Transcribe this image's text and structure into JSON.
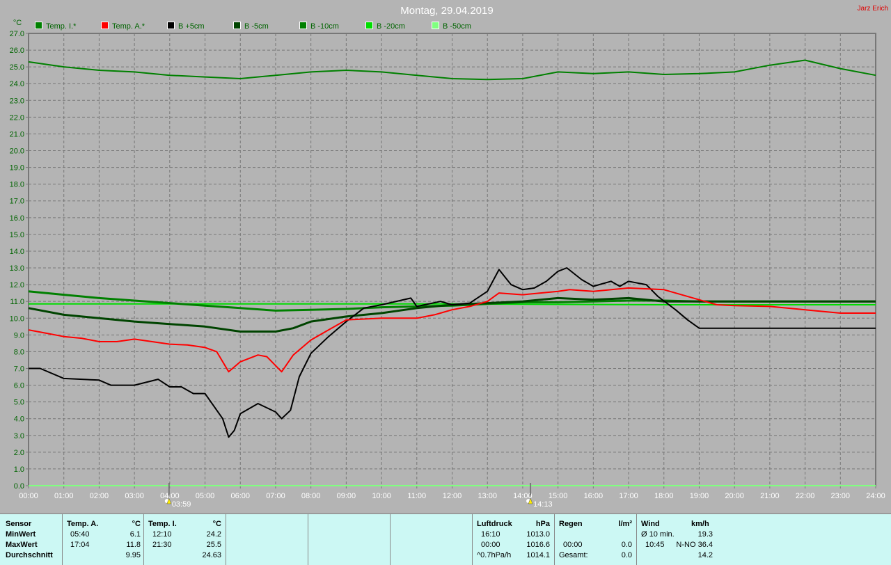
{
  "title": "Montag, 29.04.2019",
  "author": "Jarz Erich",
  "chart_data": {
    "type": "line",
    "title": "Montag, 29.04.2019",
    "ylabel": "°C",
    "xlabel": "",
    "ylim": [
      0,
      27
    ],
    "xlim": [
      0,
      24
    ],
    "grid": true,
    "legend_position": "top",
    "yticks": [
      "0.0",
      "1.0",
      "2.0",
      "3.0",
      "4.0",
      "5.0",
      "6.0",
      "7.0",
      "8.0",
      "9.0",
      "10.0",
      "11.0",
      "12.0",
      "13.0",
      "14.0",
      "15.0",
      "16.0",
      "17.0",
      "18.0",
      "19.0",
      "20.0",
      "21.0",
      "22.0",
      "23.0",
      "24.0",
      "25.0",
      "26.0",
      "27.0"
    ],
    "xticks": [
      "00:00",
      "01:00",
      "02:00",
      "03:00",
      "04:00",
      "05:00",
      "06:00",
      "07:00",
      "08:00",
      "09:00",
      "10:00",
      "11:00",
      "12:00",
      "13:00",
      "14:00",
      "15:00",
      "16:00",
      "17:00",
      "18:00",
      "19:00",
      "20:00",
      "21:00",
      "22:00",
      "23:00",
      "24:00"
    ],
    "markers": [
      {
        "label": "03:59",
        "hour": 3.98,
        "icon": "sunrise-icon"
      },
      {
        "label": "14:13",
        "hour": 14.22,
        "icon": "sunset-icon"
      }
    ],
    "series": [
      {
        "name": "Temp. I.*",
        "color": "#008000",
        "width": 2,
        "points": [
          [
            0,
            25.3
          ],
          [
            1,
            25.0
          ],
          [
            2,
            24.8
          ],
          [
            3,
            24.7
          ],
          [
            4,
            24.5
          ],
          [
            5,
            24.4
          ],
          [
            6,
            24.3
          ],
          [
            7,
            24.5
          ],
          [
            8,
            24.7
          ],
          [
            9,
            24.8
          ],
          [
            10,
            24.7
          ],
          [
            11,
            24.5
          ],
          [
            12,
            24.3
          ],
          [
            13,
            24.25
          ],
          [
            14,
            24.3
          ],
          [
            15,
            24.7
          ],
          [
            16,
            24.6
          ],
          [
            17,
            24.7
          ],
          [
            18,
            24.55
          ],
          [
            19,
            24.6
          ],
          [
            20,
            24.7
          ],
          [
            21,
            25.1
          ],
          [
            22,
            25.4
          ],
          [
            23,
            24.9
          ],
          [
            24,
            24.5
          ]
        ]
      },
      {
        "name": "Temp. A.*",
        "color": "#ff0000",
        "width": 2,
        "points": [
          [
            0,
            9.3
          ],
          [
            0.5,
            9.1
          ],
          [
            1,
            8.9
          ],
          [
            1.5,
            8.8
          ],
          [
            2,
            8.6
          ],
          [
            2.5,
            8.6
          ],
          [
            3,
            8.75
          ],
          [
            3.5,
            8.6
          ],
          [
            4,
            8.45
          ],
          [
            4.5,
            8.4
          ],
          [
            5,
            8.25
          ],
          [
            5.33,
            8.0
          ],
          [
            5.67,
            6.8
          ],
          [
            6,
            7.4
          ],
          [
            6.5,
            7.8
          ],
          [
            6.75,
            7.7
          ],
          [
            7.17,
            6.8
          ],
          [
            7.5,
            7.8
          ],
          [
            8,
            8.7
          ],
          [
            8.5,
            9.3
          ],
          [
            9,
            9.9
          ],
          [
            10,
            10.0
          ],
          [
            10.5,
            10.0
          ],
          [
            11,
            10.0
          ],
          [
            11.5,
            10.2
          ],
          [
            12,
            10.5
          ],
          [
            12.5,
            10.7
          ],
          [
            13,
            11.0
          ],
          [
            13.33,
            11.5
          ],
          [
            14,
            11.4
          ],
          [
            15,
            11.6
          ],
          [
            15.33,
            11.7
          ],
          [
            16,
            11.6
          ],
          [
            17,
            11.8
          ],
          [
            18,
            11.7
          ],
          [
            18.5,
            11.4
          ],
          [
            19,
            11.1
          ],
          [
            19.5,
            10.8
          ],
          [
            20,
            10.75
          ],
          [
            21,
            10.7
          ],
          [
            22,
            10.5
          ],
          [
            23,
            10.3
          ],
          [
            24,
            10.3
          ]
        ]
      },
      {
        "name": "B +5cm",
        "color": "#000000",
        "width": 2,
        "points": [
          [
            0,
            7.0
          ],
          [
            0.33,
            7.0
          ],
          [
            1,
            6.4
          ],
          [
            2,
            6.3
          ],
          [
            2.33,
            6.0
          ],
          [
            3,
            6.0
          ],
          [
            3.67,
            6.35
          ],
          [
            4,
            5.9
          ],
          [
            4.33,
            5.9
          ],
          [
            4.67,
            5.5
          ],
          [
            5,
            5.5
          ],
          [
            5.5,
            4.0
          ],
          [
            5.67,
            2.9
          ],
          [
            5.83,
            3.3
          ],
          [
            6,
            4.3
          ],
          [
            6.5,
            4.9
          ],
          [
            7,
            4.4
          ],
          [
            7.17,
            4.0
          ],
          [
            7.42,
            4.5
          ],
          [
            7.67,
            6.5
          ],
          [
            8,
            7.9
          ],
          [
            8.5,
            8.9
          ],
          [
            9,
            9.8
          ],
          [
            9.5,
            10.6
          ],
          [
            10,
            10.8
          ],
          [
            10.83,
            11.2
          ],
          [
            11,
            10.7
          ],
          [
            11.67,
            11.0
          ],
          [
            12,
            10.8
          ],
          [
            12.5,
            10.9
          ],
          [
            13,
            11.6
          ],
          [
            13.33,
            12.9
          ],
          [
            13.67,
            12.0
          ],
          [
            14,
            11.7
          ],
          [
            14.33,
            11.8
          ],
          [
            14.67,
            12.2
          ],
          [
            15,
            12.8
          ],
          [
            15.25,
            13.0
          ],
          [
            15.67,
            12.3
          ],
          [
            16,
            11.9
          ],
          [
            16.5,
            12.2
          ],
          [
            16.75,
            11.9
          ],
          [
            17,
            12.2
          ],
          [
            17.5,
            12.0
          ],
          [
            17.83,
            11.3
          ],
          [
            18.33,
            10.5
          ],
          [
            18.67,
            9.9
          ],
          [
            19,
            9.4
          ],
          [
            24,
            9.4
          ]
        ]
      },
      {
        "name": "B -5cm",
        "color": "#004400",
        "width": 3,
        "points": [
          [
            0,
            10.6
          ],
          [
            1,
            10.2
          ],
          [
            2,
            10.0
          ],
          [
            3,
            9.8
          ],
          [
            4,
            9.65
          ],
          [
            5,
            9.5
          ],
          [
            6,
            9.2
          ],
          [
            7,
            9.2
          ],
          [
            7.5,
            9.4
          ],
          [
            8,
            9.8
          ],
          [
            9,
            10.1
          ],
          [
            10,
            10.3
          ],
          [
            11,
            10.6
          ],
          [
            12,
            10.8
          ],
          [
            13,
            10.9
          ],
          [
            14,
            11.0
          ],
          [
            15,
            11.2
          ],
          [
            16,
            11.1
          ],
          [
            17,
            11.2
          ],
          [
            18,
            11.0
          ],
          [
            19,
            11.0
          ],
          [
            24,
            11.0
          ]
        ]
      },
      {
        "name": "B -10cm",
        "color": "#008000",
        "width": 3,
        "points": [
          [
            0,
            11.6
          ],
          [
            1,
            11.4
          ],
          [
            2,
            11.2
          ],
          [
            3,
            11.05
          ],
          [
            4,
            10.9
          ],
          [
            5,
            10.75
          ],
          [
            6,
            10.6
          ],
          [
            7,
            10.45
          ],
          [
            8,
            10.5
          ],
          [
            9,
            10.55
          ],
          [
            10,
            10.65
          ],
          [
            11,
            10.7
          ],
          [
            12,
            10.75
          ],
          [
            13,
            10.85
          ],
          [
            14,
            10.95
          ],
          [
            15,
            10.95
          ],
          [
            16,
            11.0
          ],
          [
            17,
            11.05
          ],
          [
            18,
            11.05
          ],
          [
            19,
            11.0
          ],
          [
            24,
            11.0
          ]
        ]
      },
      {
        "name": "B -20cm",
        "color": "#00dd00",
        "width": 2,
        "points": [
          [
            0,
            10.85
          ],
          [
            12,
            10.85
          ],
          [
            18,
            10.8
          ],
          [
            24,
            10.8
          ]
        ]
      },
      {
        "name": "B -50cm",
        "color": "#80ff80",
        "width": 2,
        "points": [
          [
            0,
            0.0
          ],
          [
            24,
            0.0
          ]
        ]
      }
    ]
  },
  "panel": {
    "sensor": {
      "header": "Sensor",
      "rows": [
        "MinWert",
        "MaxWert",
        "Durchschnitt"
      ]
    },
    "temp_a": {
      "header": "Temp. A.",
      "unit": "°C",
      "min_time": "05:40",
      "min": "6.1",
      "max_time": "17:04",
      "max": "11.8",
      "avg": "9.95"
    },
    "temp_i": {
      "header": "Temp. I.",
      "unit": "°C",
      "min_time": "12:10",
      "min": "24.2",
      "max_time": "21:30",
      "max": "25.5",
      "avg": "24.63"
    },
    "pressure": {
      "header": "Luftdruck",
      "unit": "hPa",
      "r1_label": "16:10",
      "r1": "1013.0",
      "r2_label": "00:00",
      "r2": "1016.6",
      "r3_label": "^0.7hPa/h",
      "r3": "1014.1"
    },
    "rain": {
      "header": "Regen",
      "unit": "l/m²",
      "r2_label": "00:00",
      "r2": "0.0",
      "r3_label": "Gesamt:",
      "r3": "0.0"
    },
    "wind": {
      "header": "Wind",
      "unit": "km/h",
      "r1_label": "Ø 10 min.",
      "r1": "19.3",
      "r2_label": "10:45",
      "r2": "N-NO 36.4",
      "r3": "14.2"
    }
  }
}
